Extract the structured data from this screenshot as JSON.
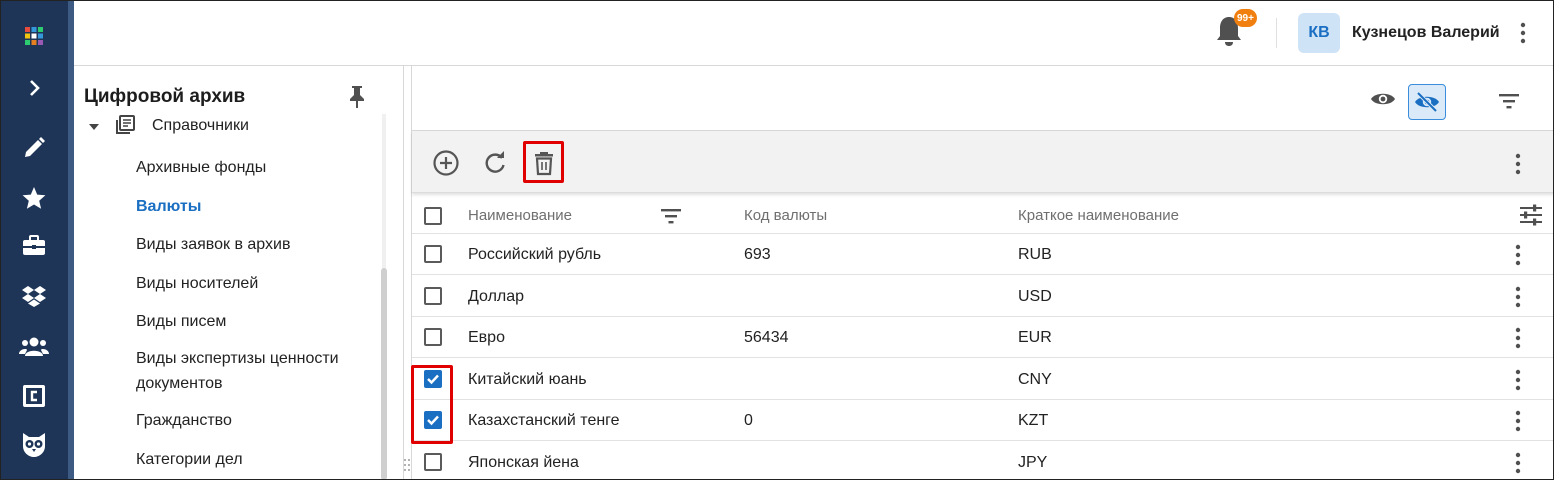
{
  "rail": {
    "items": [
      {
        "name": "apps-grid-icon"
      },
      {
        "name": "expand-chevron-icon"
      },
      {
        "name": "pencil-icon"
      },
      {
        "name": "star-icon"
      },
      {
        "name": "toolbox-icon"
      },
      {
        "name": "dropbox-icon"
      },
      {
        "name": "users-icon"
      },
      {
        "name": "c-box-icon"
      },
      {
        "name": "owl-icon"
      }
    ]
  },
  "header": {
    "notification_badge": "99+",
    "user_initials": "КВ",
    "user_name": "Кузнецов Валерий"
  },
  "sidebar": {
    "title": "Цифровой архив",
    "tree_root": "Справочники",
    "items": [
      {
        "label": "Архивные фонды",
        "active": false
      },
      {
        "label": "Валюты",
        "active": true
      },
      {
        "label": "Виды заявок в архив",
        "active": false
      },
      {
        "label": "Виды носителей",
        "active": false
      },
      {
        "label": "Виды писем",
        "active": false
      },
      {
        "label": "Виды экспертизы ценности документов",
        "active": false
      },
      {
        "label": "Гражданство",
        "active": false
      },
      {
        "label": "Категории дел",
        "active": false
      }
    ]
  },
  "toolbar": {
    "icons": [
      "add-circle-icon",
      "refresh-icon",
      "trash-icon"
    ]
  },
  "table": {
    "columns": [
      "Наименование",
      "Код валюты",
      "Краткое наименование"
    ],
    "rows": [
      {
        "name": "Российский рубль",
        "code": "693",
        "short": "RUB",
        "checked": false
      },
      {
        "name": "Доллар",
        "code": "",
        "short": "USD",
        "checked": false
      },
      {
        "name": "Евро",
        "code": "56434",
        "short": "EUR",
        "checked": false
      },
      {
        "name": "Китайский юань",
        "code": "",
        "short": "CNY",
        "checked": true
      },
      {
        "name": "Казахстанский тенге",
        "code": "0",
        "short": "KZT",
        "checked": true
      },
      {
        "name": "Японская йена",
        "code": "",
        "short": "JPY",
        "checked": false
      }
    ]
  },
  "colors": {
    "rail_bg": "#1e3557",
    "accent": "#1b6fc2",
    "badge": "#f07f10",
    "highlight": "#e00000"
  }
}
